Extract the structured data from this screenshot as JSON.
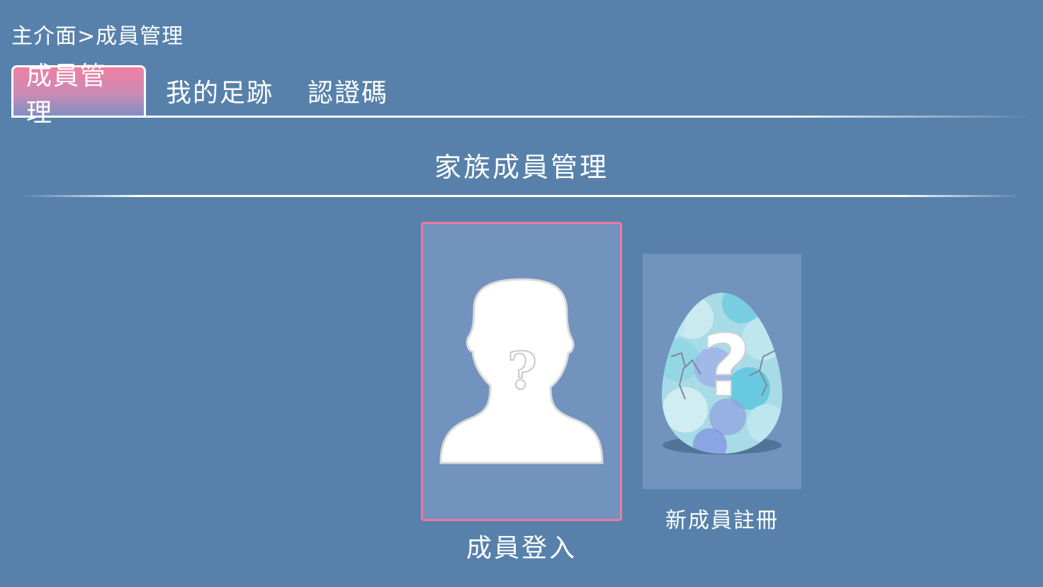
{
  "breadcrumb": "主介面>成員管理",
  "tabs": [
    {
      "label": "成員管理",
      "active": true
    },
    {
      "label": "我的足跡",
      "active": false
    },
    {
      "label": "認證碼",
      "active": false
    }
  ],
  "section": {
    "title": "家族成員管理"
  },
  "cards": {
    "login": {
      "label": "成員登入",
      "icon": "unknown-person-icon",
      "selected": true
    },
    "register": {
      "label": "新成員註冊",
      "icon": "mystery-egg-icon",
      "selected": false
    }
  },
  "colors": {
    "background": "#5781ab",
    "card": "#7193bd",
    "selection_border": "#f0799f",
    "active_tab_top": "#f07ea2"
  }
}
